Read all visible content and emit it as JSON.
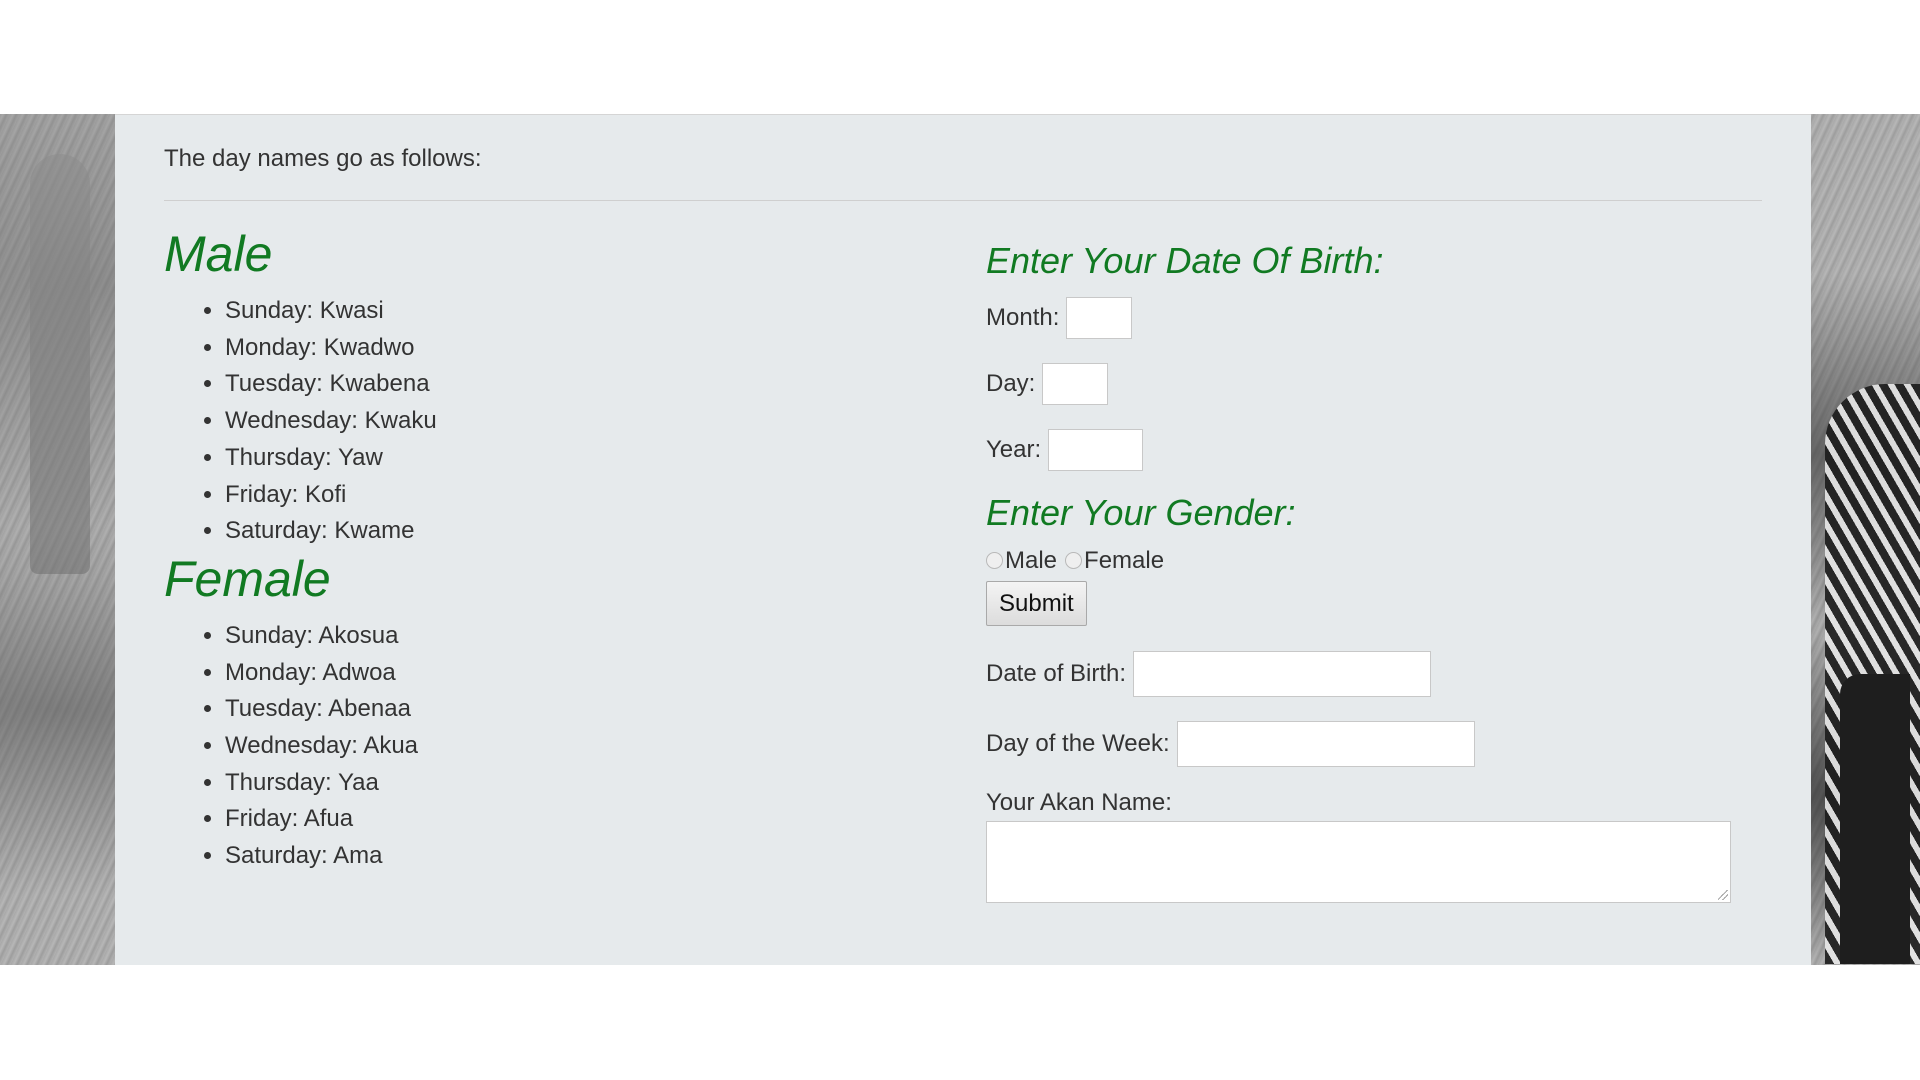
{
  "intro_text": "The day names go as follows:",
  "male": {
    "title": "Male",
    "names": [
      "Sunday: Kwasi",
      "Monday: Kwadwo",
      "Tuesday: Kwabena",
      "Wednesday: Kwaku",
      "Thursday: Yaw",
      "Friday: Kofi",
      "Saturday: Kwame"
    ]
  },
  "female": {
    "title": "Female",
    "names": [
      "Sunday: Akosua",
      "Monday: Adwoa",
      "Tuesday: Abenaa",
      "Wednesday: Akua",
      "Thursday: Yaa",
      "Friday: Afua",
      "Saturday: Ama"
    ]
  },
  "form": {
    "dob_heading": "Enter Your Date Of Birth:",
    "month_label": "Month:",
    "month_value": "",
    "day_label": "Day:",
    "day_value": "",
    "year_label": "Year:",
    "year_value": "",
    "gender_heading": "Enter Your Gender:",
    "gender_options": [
      "Male",
      "Female"
    ],
    "submit_label": "Submit",
    "dob_output_label": "Date of Birth:",
    "dob_output_value": "",
    "weekday_output_label": "Day of the Week:",
    "weekday_output_value": "",
    "akan_name_label": "Your Akan Name:",
    "akan_name_value": ""
  },
  "colors": {
    "heading_green": "#117a22",
    "panel_background": "#e6eaec"
  }
}
